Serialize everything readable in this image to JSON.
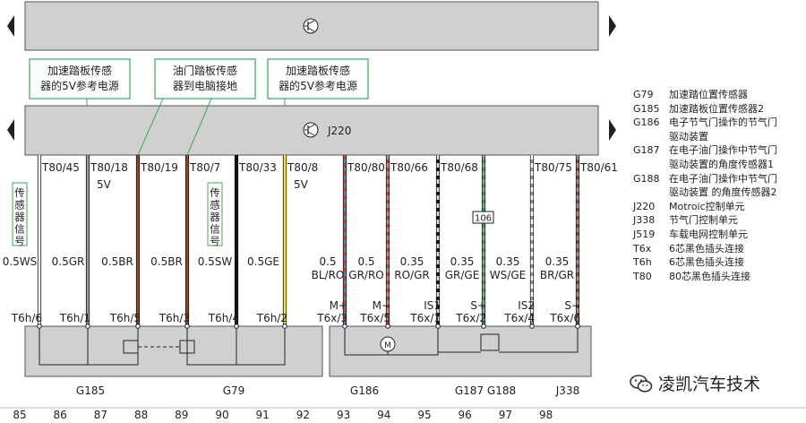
{
  "top_unit": {
    "label": ""
  },
  "ecu": {
    "label": "J220"
  },
  "callouts": [
    "加速踏板传感\n器的5V参考电源",
    "油门踏板传感\n器到电脑接地",
    "加速踏板传感\n器的5V参考电源"
  ],
  "vertical_labels": [
    "传感器信号",
    "传感器信号"
  ],
  "wires": [
    {
      "pin": "T80/45",
      "extra": "",
      "size": "0.5WS",
      "code": "",
      "conn": "T6h/6",
      "colors": [
        "#ffffff"
      ]
    },
    {
      "pin": "T80/18",
      "extra": "5V",
      "size": "0.5GR",
      "code": "",
      "conn": "T6h/1",
      "colors": [
        "#9a9a9a"
      ]
    },
    {
      "pin": "T80/19",
      "extra": "",
      "size": "0.5BR",
      "code": "",
      "conn": "T6h/5",
      "colors": [
        "#8b4a2a"
      ]
    },
    {
      "pin": "T80/7",
      "extra": "",
      "size": "0.5BR",
      "code": "",
      "conn": "T6h/3",
      "colors": [
        "#8b4a2a"
      ]
    },
    {
      "pin": "T80/33",
      "extra": "",
      "size": "0.5SW",
      "code": "",
      "conn": "T6h/4",
      "colors": [
        "#111111"
      ]
    },
    {
      "pin": "T80/8",
      "extra": "5V",
      "size": "0.5GE",
      "code": "",
      "conn": "T6h/2",
      "colors": [
        "#f5ea2a"
      ]
    },
    {
      "pin": "",
      "extra": "",
      "size": "0.5",
      "code": "BL/RO",
      "conn": "",
      "colors": []
    },
    {
      "pin": "T80/80",
      "extra": "",
      "size": "0.5",
      "code": "GR/RO",
      "conn": "M+\nT6x/3",
      "colors": [
        "#4a8ad0",
        "#d23a2e"
      ]
    },
    {
      "pin": "T80/66",
      "extra": "",
      "size": "0.35",
      "code": "RO/GR",
      "conn": "M−\nT6x/5",
      "colors": [
        "#d23a2e",
        "#9a9a9a"
      ]
    },
    {
      "pin": "T80/68",
      "extra": "",
      "size": "0.35",
      "code": "GR/GE",
      "conn": "IS1\nT6x/1",
      "colors": [
        "#111111",
        "#dddddd"
      ]
    },
    {
      "pin": "",
      "extra": "",
      "size": "0.35",
      "code": "WS/GE",
      "conn": "S+\nT6x/2",
      "colors": [
        "#2fa44f",
        "#9a9a9a"
      ]
    },
    {
      "pin": "T80/75",
      "extra": "",
      "size": "0.35",
      "code": "BR/GR",
      "conn": "IS2\nT6x/4",
      "colors": [
        "#9a9a9a",
        "#ffffff"
      ]
    },
    {
      "pin": "T80/61",
      "extra": "",
      "size": "",
      "code": "",
      "conn": "S−\nT6x/6",
      "colors": [
        "#8b4a2a",
        "#9a9a9a"
      ]
    }
  ],
  "badge": "106",
  "components": [
    "G185",
    "G79",
    "G186",
    "G187 G188",
    "J338"
  ],
  "grid_numbers": [
    "85",
    "86",
    "87",
    "88",
    "89",
    "90",
    "91",
    "92",
    "93",
    "94",
    "95",
    "96",
    "97",
    "98"
  ],
  "legend": [
    {
      "code": "G79",
      "desc": "加速踏位置传感器"
    },
    {
      "code": "G185",
      "desc": "加速踏板位置传感器2"
    },
    {
      "code": "G186",
      "desc": "电子节气门操作的节气门\n驱动装置"
    },
    {
      "code": "G187",
      "desc": "在电子油门操作中节气门\n驱动装置的角度传感器1"
    },
    {
      "code": "G188",
      "desc": "在电子油门操作中节气门\n驱动装置 的角度传感器2"
    },
    {
      "code": "J220",
      "desc": "Motroic控制单元"
    },
    {
      "code": "J338",
      "desc": "节气门控制单元"
    },
    {
      "code": "J519",
      "desc": "车载电网控制单元"
    },
    {
      "code": "T6x",
      "desc": "6芯黑色插头连接"
    },
    {
      "code": "T6h",
      "desc": "6芯黑色插头连接"
    },
    {
      "code": "T80",
      "desc": "80芯黑色插头连接"
    }
  ],
  "watermark": "凌凯汽车技术",
  "colors": {
    "panel": "#d0d0d0",
    "panel_border": "#555555",
    "callout_border": "#3aa85a",
    "accent_green": "#2fa44f"
  }
}
